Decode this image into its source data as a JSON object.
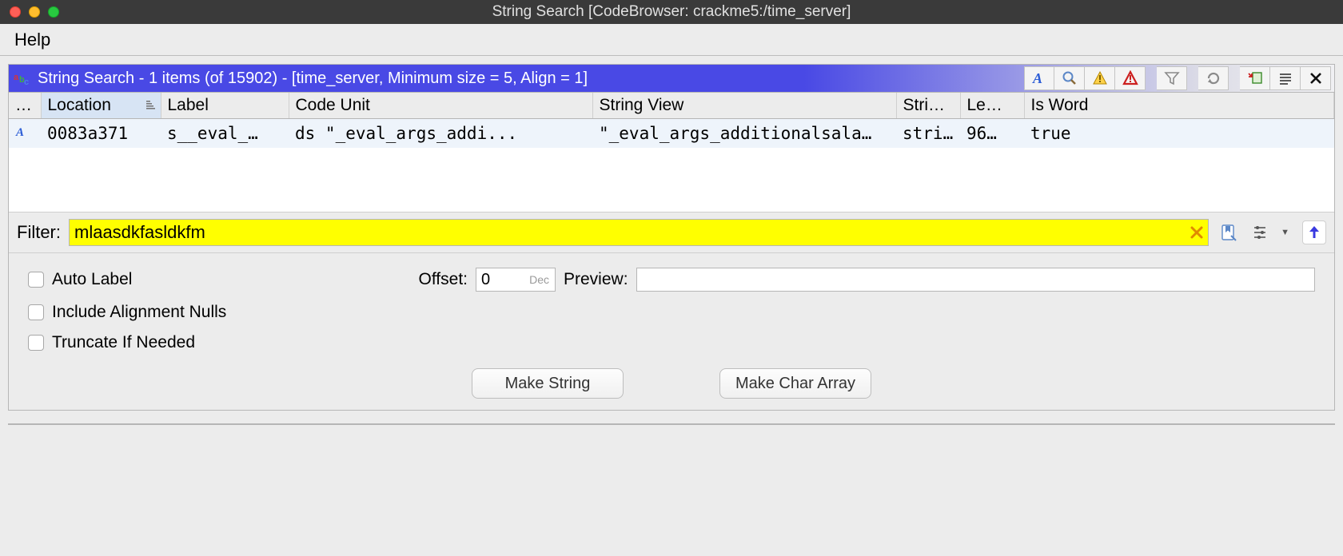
{
  "window": {
    "title": "String Search [CodeBrowser: crackme5:/time_server]"
  },
  "menubar": {
    "help": "Help"
  },
  "panel": {
    "title": "String Search - 1 items (of 15902) - [time_server, Minimum size = 5, Align = 1]"
  },
  "toolbar_icons": {
    "font": "toggle-font-a-icon",
    "magnifier": "magnifier-icon",
    "warn1": "warning-outline-icon",
    "warn2": "warning-filled-icon",
    "funnel": "filter-funnel-icon",
    "refresh": "refresh-icon",
    "select": "selection-icon",
    "lines": "lines-icon",
    "close": "close-icon"
  },
  "columns": [
    {
      "label": "…"
    },
    {
      "label": "Location"
    },
    {
      "label": "Label"
    },
    {
      "label": "Code Unit"
    },
    {
      "label": "String View"
    },
    {
      "label": "Stri…"
    },
    {
      "label": "Le…"
    },
    {
      "label": "Is Word"
    }
  ],
  "rows": [
    {
      "icon": "A",
      "location": "0083a371",
      "label": "s__eval_…",
      "code_unit": "ds  \"_eval_args_addi...",
      "string_view": "\"_eval_args_additionalsala…",
      "string_type": "stri…",
      "length": "96…",
      "is_word": "true"
    }
  ],
  "filter": {
    "label": "Filter:",
    "value": "mlaasdkfasldkfm"
  },
  "options": {
    "auto_label": "Auto Label",
    "include_nulls": "Include Alignment Nulls",
    "truncate": "Truncate If Needed",
    "offset_label": "Offset:",
    "offset_value": "0",
    "offset_mode": "Dec",
    "preview_label": "Preview:",
    "make_string": "Make String",
    "make_char_array": "Make Char Array"
  }
}
